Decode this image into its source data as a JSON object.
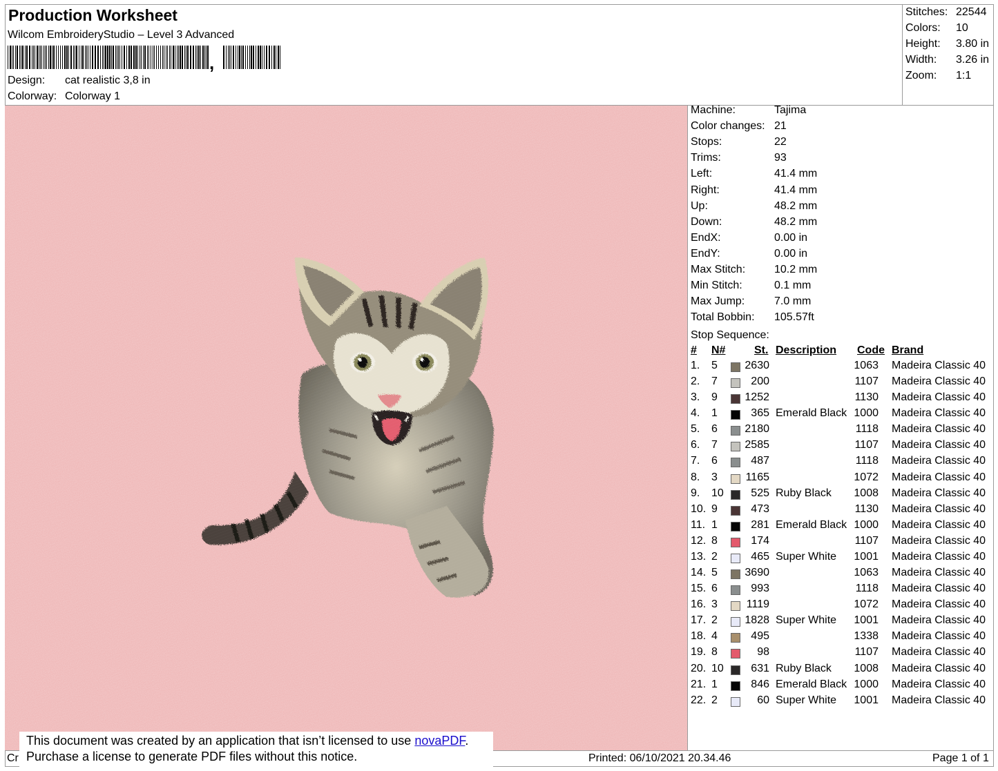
{
  "header": {
    "title": "Production Worksheet",
    "software": "Wilcom EmbroideryStudio – Level 3 Advanced",
    "barcode_separator": ",",
    "design_label": "Design:",
    "design_value": "cat realistic 3,8 in",
    "colorway_label": "Colorway:",
    "colorway_value": "Colorway 1"
  },
  "summary": [
    {
      "label": "Stitches:",
      "value": "22544"
    },
    {
      "label": "Colors:",
      "value": "10"
    },
    {
      "label": "Height:",
      "value": "3.80 in"
    },
    {
      "label": "Width:",
      "value": "3.26 in"
    },
    {
      "label": "Zoom:",
      "value": "1:1"
    }
  ],
  "machine_info": [
    {
      "label": "Machine:",
      "value": "Tajima"
    },
    {
      "label": "Color changes:",
      "value": "21"
    },
    {
      "label": "Stops:",
      "value": "22"
    },
    {
      "label": "Trims:",
      "value": "93"
    },
    {
      "label": "Left:",
      "value": "41.4 mm"
    },
    {
      "label": "Right:",
      "value": "41.4 mm"
    },
    {
      "label": "Up:",
      "value": "48.2 mm"
    },
    {
      "label": "Down:",
      "value": "48.2 mm"
    },
    {
      "label": "EndX:",
      "value": "0.00 in"
    },
    {
      "label": "EndY:",
      "value": "0.00 in"
    },
    {
      "label": "Max Stitch:",
      "value": "10.2 mm"
    },
    {
      "label": "Min Stitch:",
      "value": "0.1 mm"
    },
    {
      "label": "Max Jump:",
      "value": "7.0 mm"
    },
    {
      "label": "Total Bobbin:",
      "value": "105.57ft"
    }
  ],
  "stop_sequence": {
    "title": "Stop Sequence:",
    "headers": {
      "num": "#",
      "needle": "N#",
      "stitches": "St.",
      "description": "Description",
      "code": "Code",
      "brand": "Brand"
    },
    "rows": [
      {
        "num": "1.",
        "needle": "5",
        "color": "#7d7564",
        "stitches": "2630",
        "description": "",
        "code": "1063",
        "brand": "Madeira Classic 40"
      },
      {
        "num": "2.",
        "needle": "7",
        "color": "#c4c3bd",
        "stitches": "200",
        "description": "",
        "code": "1107",
        "brand": "Madeira Classic 40"
      },
      {
        "num": "3.",
        "needle": "9",
        "color": "#4a3535",
        "stitches": "1252",
        "description": "",
        "code": "1130",
        "brand": "Madeira Classic 40"
      },
      {
        "num": "4.",
        "needle": "1",
        "color": "#050505",
        "stitches": "365",
        "description": "Emerald Black",
        "code": "1000",
        "brand": "Madeira Classic 40"
      },
      {
        "num": "5.",
        "needle": "6",
        "color": "#8a8e8e",
        "stitches": "2180",
        "description": "",
        "code": "1118",
        "brand": "Madeira Classic 40"
      },
      {
        "num": "6.",
        "needle": "7",
        "color": "#c4c3bd",
        "stitches": "2585",
        "description": "",
        "code": "1107",
        "brand": "Madeira Classic 40"
      },
      {
        "num": "7.",
        "needle": "6",
        "color": "#8a8e8e",
        "stitches": "487",
        "description": "",
        "code": "1118",
        "brand": "Madeira Classic 40"
      },
      {
        "num": "8.",
        "needle": "3",
        "color": "#e3d8c4",
        "stitches": "1165",
        "description": "",
        "code": "1072",
        "brand": "Madeira Classic 40"
      },
      {
        "num": "9.",
        "needle": "10",
        "color": "#2a2828",
        "stitches": "525",
        "description": "Ruby Black",
        "code": "1008",
        "brand": "Madeira Classic 40"
      },
      {
        "num": "10.",
        "needle": "9",
        "color": "#4a3535",
        "stitches": "473",
        "description": "",
        "code": "1130",
        "brand": "Madeira Classic 40"
      },
      {
        "num": "11.",
        "needle": "1",
        "color": "#050505",
        "stitches": "281",
        "description": "Emerald Black",
        "code": "1000",
        "brand": "Madeira Classic 40"
      },
      {
        "num": "12.",
        "needle": "8",
        "color": "#e35a6c",
        "stitches": "174",
        "description": "",
        "code": "1107",
        "brand": "Madeira Classic 40"
      },
      {
        "num": "13.",
        "needle": "2",
        "color": "#e8eaf8",
        "stitches": "465",
        "description": "Super White",
        "code": "1001",
        "brand": "Madeira Classic 40"
      },
      {
        "num": "14.",
        "needle": "5",
        "color": "#7d7564",
        "stitches": "3690",
        "description": "",
        "code": "1063",
        "brand": "Madeira Classic 40"
      },
      {
        "num": "15.",
        "needle": "6",
        "color": "#8a8e8e",
        "stitches": "993",
        "description": "",
        "code": "1118",
        "brand": "Madeira Classic 40"
      },
      {
        "num": "16.",
        "needle": "3",
        "color": "#e3d8c4",
        "stitches": "1119",
        "description": "",
        "code": "1072",
        "brand": "Madeira Classic 40"
      },
      {
        "num": "17.",
        "needle": "2",
        "color": "#e8eaf8",
        "stitches": "1828",
        "description": "Super White",
        "code": "1001",
        "brand": "Madeira Classic 40"
      },
      {
        "num": "18.",
        "needle": "4",
        "color": "#a88f6c",
        "stitches": "495",
        "description": "",
        "code": "1338",
        "brand": "Madeira Classic 40"
      },
      {
        "num": "19.",
        "needle": "8",
        "color": "#e35a6c",
        "stitches": "98",
        "description": "",
        "code": "1107",
        "brand": "Madeira Classic 40"
      },
      {
        "num": "20.",
        "needle": "10",
        "color": "#2a2828",
        "stitches": "631",
        "description": "Ruby Black",
        "code": "1008",
        "brand": "Madeira Classic 40"
      },
      {
        "num": "21.",
        "needle": "1",
        "color": "#050505",
        "stitches": "846",
        "description": "Emerald Black",
        "code": "1000",
        "brand": "Madeira Classic 40"
      },
      {
        "num": "22.",
        "needle": "2",
        "color": "#e8eaf8",
        "stitches": "60",
        "description": "Super White",
        "code": "1001",
        "brand": "Madeira Classic 40"
      }
    ]
  },
  "footer": {
    "left_fragment": "Cr",
    "notice_line1": "This document was created by an application that isn’t licensed to use ",
    "notice_link": "novaPDF",
    "notice_period": ".",
    "notice_line2": "Purchase a license to generate PDF files without this notice.",
    "printed": "Printed: 06/10/2021 20.34.46",
    "page": "Page 1 of 1"
  },
  "colors": {
    "fabric": "#eeb3b3",
    "border": "#9a9a9a",
    "link": "#1a0dcc"
  }
}
